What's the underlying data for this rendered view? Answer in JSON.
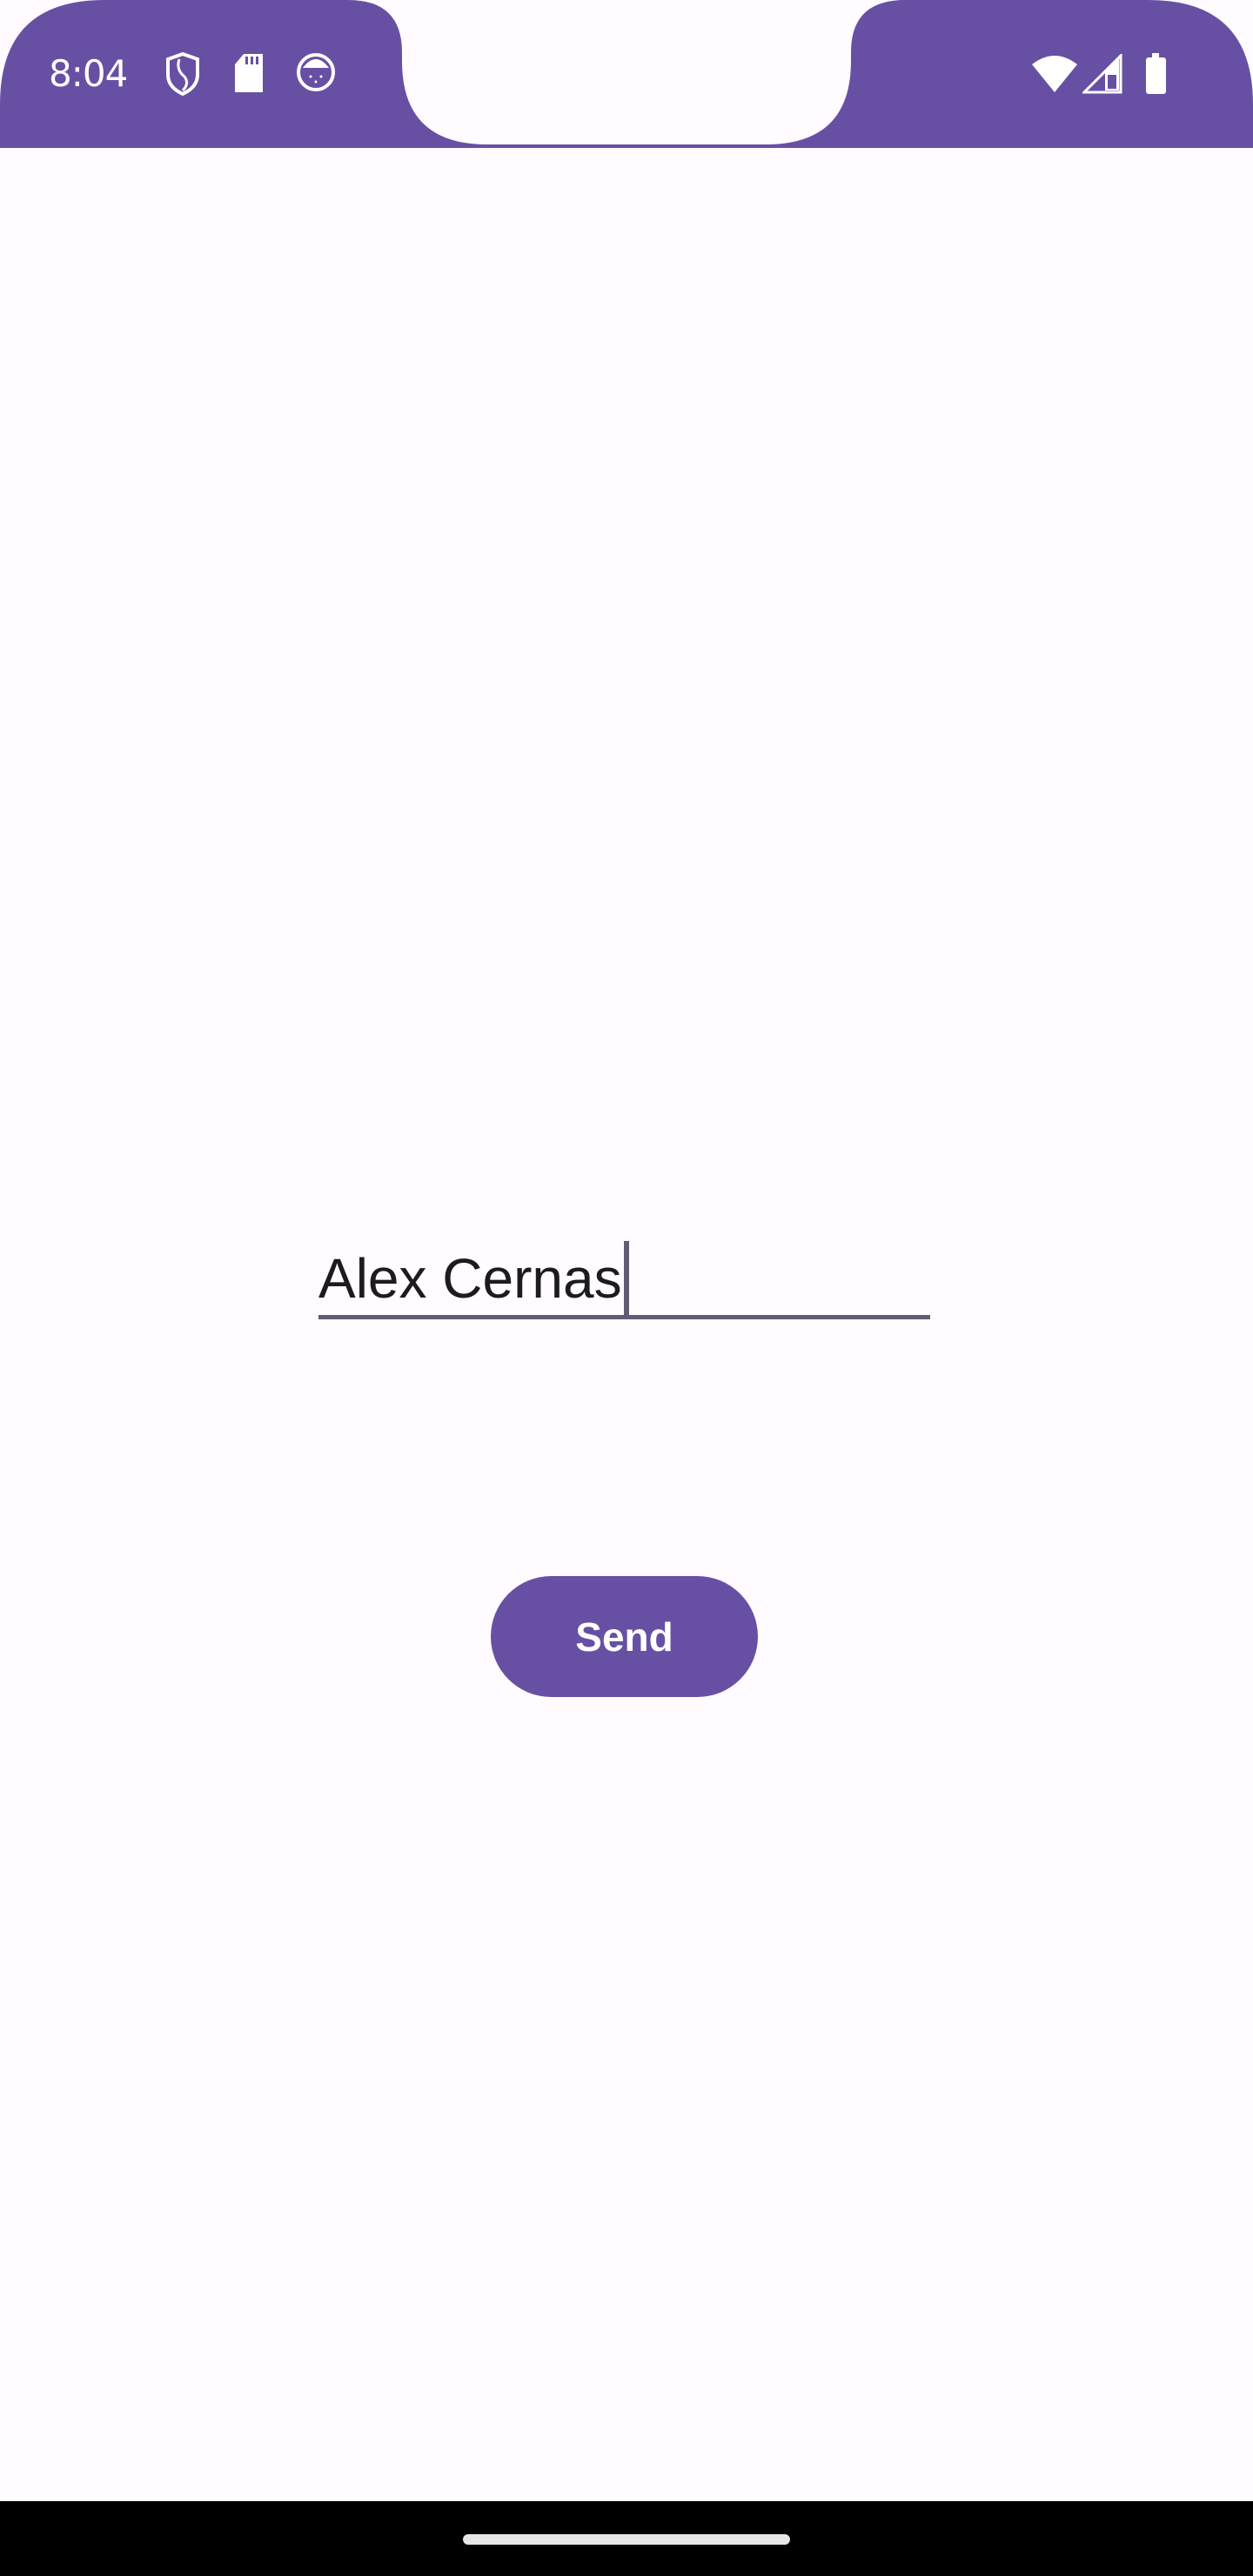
{
  "status_bar": {
    "time": "8:04",
    "left_icons": [
      "shield-icon",
      "sd-card-icon",
      "cat-face-icon"
    ],
    "right_icons": [
      "wifi-icon",
      "cellular-signal-icon",
      "battery-icon"
    ],
    "color": "#6750a4"
  },
  "form": {
    "name_input_value": "Alex Cernas",
    "send_label": "Send"
  },
  "colors": {
    "accent": "#6750a4",
    "background": "#fffbfe",
    "underline": "#625b71"
  }
}
